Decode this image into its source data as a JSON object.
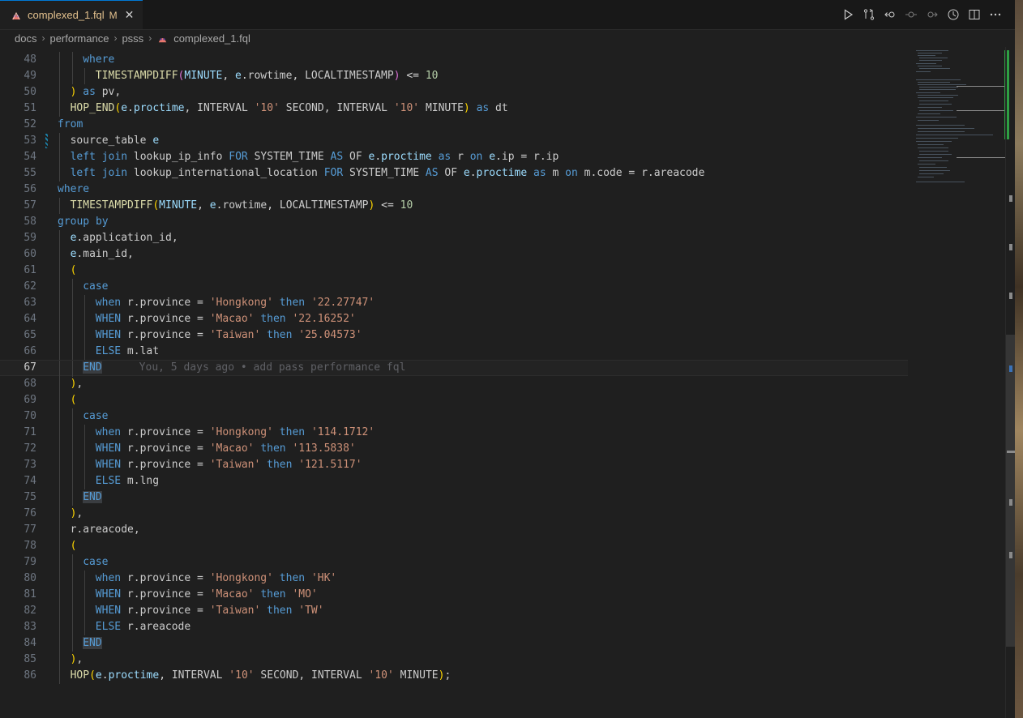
{
  "tab": {
    "title": "complexed_1.fql",
    "modified": "M"
  },
  "breadcrumbs": [
    "docs",
    "performance",
    "psss",
    "complexed_1.fql"
  ],
  "editor": {
    "blame": "You, 5 days ago • add pass performance fql",
    "current_line": "67",
    "lines": [
      {
        "n": "48",
        "indent": 2,
        "tokens": [
          [
            "kw",
            "where"
          ]
        ]
      },
      {
        "n": "49",
        "indent": 3,
        "tokens": [
          [
            "fn",
            "TIMESTAMPDIFF"
          ],
          [
            "p2",
            "("
          ],
          [
            "var",
            "MINUTE"
          ],
          [
            "op",
            ", "
          ],
          [
            "var",
            "e"
          ],
          [
            "op",
            "."
          ],
          [
            "plain",
            "rowtime"
          ],
          [
            "op",
            ", "
          ],
          [
            "plain",
            "LOCALTIMESTAMP"
          ],
          [
            "p2",
            ")"
          ],
          [
            "op",
            " <= "
          ],
          [
            "num",
            "10"
          ]
        ]
      },
      {
        "n": "50",
        "indent": 1,
        "tokens": [
          [
            "p1",
            ")"
          ],
          [
            "plain",
            " "
          ],
          [
            "kw",
            "as"
          ],
          [
            "plain",
            " pv,"
          ]
        ]
      },
      {
        "n": "51",
        "indent": 1,
        "tokens": [
          [
            "fn",
            "HOP_END"
          ],
          [
            "p1",
            "("
          ],
          [
            "var",
            "e"
          ],
          [
            "op",
            "."
          ],
          [
            "var",
            "proctime"
          ],
          [
            "op",
            ", "
          ],
          [
            "plain",
            "INTERVAL "
          ],
          [
            "str",
            "'10'"
          ],
          [
            "plain",
            " SECOND, INTERVAL "
          ],
          [
            "str",
            "'10'"
          ],
          [
            "plain",
            " MINUTE"
          ],
          [
            "p1",
            ")"
          ],
          [
            "plain",
            " "
          ],
          [
            "kw",
            "as"
          ],
          [
            "plain",
            " dt"
          ]
        ]
      },
      {
        "n": "52",
        "indent": 0,
        "tokens": [
          [
            "kw",
            "from"
          ]
        ]
      },
      {
        "n": "53",
        "indent": 1,
        "mark": true,
        "tokens": [
          [
            "plain",
            "source_table "
          ],
          [
            "var",
            "e"
          ]
        ]
      },
      {
        "n": "54",
        "indent": 1,
        "tokens": [
          [
            "kw",
            "left join"
          ],
          [
            "plain",
            " lookup_ip_info "
          ],
          [
            "kw",
            "FOR"
          ],
          [
            "plain",
            " SYSTEM_TIME "
          ],
          [
            "kw",
            "AS"
          ],
          [
            "plain",
            " OF "
          ],
          [
            "var",
            "e"
          ],
          [
            "op",
            "."
          ],
          [
            "var",
            "proctime"
          ],
          [
            "plain",
            " "
          ],
          [
            "kw",
            "as"
          ],
          [
            "plain",
            " r "
          ],
          [
            "kw",
            "on"
          ],
          [
            "plain",
            " "
          ],
          [
            "var",
            "e"
          ],
          [
            "op",
            "."
          ],
          [
            "plain",
            "ip = r.ip"
          ]
        ]
      },
      {
        "n": "55",
        "indent": 1,
        "tokens": [
          [
            "kw",
            "left join"
          ],
          [
            "plain",
            " lookup_international_location "
          ],
          [
            "kw",
            "FOR"
          ],
          [
            "plain",
            " SYSTEM_TIME "
          ],
          [
            "kw",
            "AS"
          ],
          [
            "plain",
            " OF "
          ],
          [
            "var",
            "e"
          ],
          [
            "op",
            "."
          ],
          [
            "var",
            "proctime"
          ],
          [
            "plain",
            " "
          ],
          [
            "kw",
            "as"
          ],
          [
            "plain",
            " m "
          ],
          [
            "kw",
            "on"
          ],
          [
            "plain",
            " m.code = r.areacode"
          ]
        ]
      },
      {
        "n": "56",
        "indent": 0,
        "tokens": [
          [
            "kw",
            "where"
          ]
        ]
      },
      {
        "n": "57",
        "indent": 1,
        "tokens": [
          [
            "fn",
            "TIMESTAMPDIFF"
          ],
          [
            "p1",
            "("
          ],
          [
            "var",
            "MINUTE"
          ],
          [
            "op",
            ", "
          ],
          [
            "var",
            "e"
          ],
          [
            "op",
            "."
          ],
          [
            "plain",
            "rowtime"
          ],
          [
            "op",
            ", "
          ],
          [
            "plain",
            "LOCALTIMESTAMP"
          ],
          [
            "p1",
            ")"
          ],
          [
            "op",
            " <= "
          ],
          [
            "num",
            "10"
          ]
        ]
      },
      {
        "n": "58",
        "indent": 0,
        "tokens": [
          [
            "kw",
            "group by"
          ]
        ]
      },
      {
        "n": "59",
        "indent": 1,
        "tokens": [
          [
            "var",
            "e"
          ],
          [
            "op",
            "."
          ],
          [
            "plain",
            "application_id,"
          ]
        ]
      },
      {
        "n": "60",
        "indent": 1,
        "tokens": [
          [
            "var",
            "e"
          ],
          [
            "op",
            "."
          ],
          [
            "plain",
            "main_id,"
          ]
        ]
      },
      {
        "n": "61",
        "indent": 1,
        "tokens": [
          [
            "p1",
            "("
          ]
        ]
      },
      {
        "n": "62",
        "indent": 2,
        "tokens": [
          [
            "kw",
            "case"
          ]
        ]
      },
      {
        "n": "63",
        "indent": 3,
        "tokens": [
          [
            "kw",
            "when"
          ],
          [
            "plain",
            " r.province = "
          ],
          [
            "str",
            "'Hongkong'"
          ],
          [
            "plain",
            " "
          ],
          [
            "kw",
            "then"
          ],
          [
            "plain",
            " "
          ],
          [
            "str",
            "'22.27747'"
          ]
        ]
      },
      {
        "n": "64",
        "indent": 3,
        "tokens": [
          [
            "kw",
            "WHEN"
          ],
          [
            "plain",
            " r.province = "
          ],
          [
            "str",
            "'Macao'"
          ],
          [
            "plain",
            " "
          ],
          [
            "kw",
            "then"
          ],
          [
            "plain",
            " "
          ],
          [
            "str",
            "'22.16252'"
          ]
        ]
      },
      {
        "n": "65",
        "indent": 3,
        "tokens": [
          [
            "kw",
            "WHEN"
          ],
          [
            "plain",
            " r.province = "
          ],
          [
            "str",
            "'Taiwan'"
          ],
          [
            "plain",
            " "
          ],
          [
            "kw",
            "then"
          ],
          [
            "plain",
            " "
          ],
          [
            "str",
            "'25.04573'"
          ]
        ]
      },
      {
        "n": "66",
        "indent": 3,
        "tokens": [
          [
            "kw",
            "ELSE"
          ],
          [
            "plain",
            " m.lat"
          ]
        ]
      },
      {
        "n": "67",
        "indent": 2,
        "current": true,
        "tokens": [
          [
            "endkw",
            "END"
          ]
        ]
      },
      {
        "n": "68",
        "indent": 1,
        "tokens": [
          [
            "p1",
            ")"
          ],
          [
            "plain",
            ","
          ]
        ]
      },
      {
        "n": "69",
        "indent": 1,
        "tokens": [
          [
            "p1",
            "("
          ]
        ]
      },
      {
        "n": "70",
        "indent": 2,
        "tokens": [
          [
            "kw",
            "case"
          ]
        ]
      },
      {
        "n": "71",
        "indent": 3,
        "tokens": [
          [
            "kw",
            "when"
          ],
          [
            "plain",
            " r.province = "
          ],
          [
            "str",
            "'Hongkong'"
          ],
          [
            "plain",
            " "
          ],
          [
            "kw",
            "then"
          ],
          [
            "plain",
            " "
          ],
          [
            "str",
            "'114.1712'"
          ]
        ]
      },
      {
        "n": "72",
        "indent": 3,
        "tokens": [
          [
            "kw",
            "WHEN"
          ],
          [
            "plain",
            " r.province = "
          ],
          [
            "str",
            "'Macao'"
          ],
          [
            "plain",
            " "
          ],
          [
            "kw",
            "then"
          ],
          [
            "plain",
            " "
          ],
          [
            "str",
            "'113.5838'"
          ]
        ]
      },
      {
        "n": "73",
        "indent": 3,
        "tokens": [
          [
            "kw",
            "WHEN"
          ],
          [
            "plain",
            " r.province = "
          ],
          [
            "str",
            "'Taiwan'"
          ],
          [
            "plain",
            " "
          ],
          [
            "kw",
            "then"
          ],
          [
            "plain",
            " "
          ],
          [
            "str",
            "'121.5117'"
          ]
        ]
      },
      {
        "n": "74",
        "indent": 3,
        "tokens": [
          [
            "kw",
            "ELSE"
          ],
          [
            "plain",
            " m.lng"
          ]
        ]
      },
      {
        "n": "75",
        "indent": 2,
        "tokens": [
          [
            "endkw",
            "END"
          ]
        ]
      },
      {
        "n": "76",
        "indent": 1,
        "tokens": [
          [
            "p1",
            ")"
          ],
          [
            "plain",
            ","
          ]
        ]
      },
      {
        "n": "77",
        "indent": 1,
        "tokens": [
          [
            "plain",
            "r.areacode,"
          ]
        ]
      },
      {
        "n": "78",
        "indent": 1,
        "tokens": [
          [
            "p1",
            "("
          ]
        ]
      },
      {
        "n": "79",
        "indent": 2,
        "tokens": [
          [
            "kw",
            "case"
          ]
        ]
      },
      {
        "n": "80",
        "indent": 3,
        "tokens": [
          [
            "kw",
            "when"
          ],
          [
            "plain",
            " r.province = "
          ],
          [
            "str",
            "'Hongkong'"
          ],
          [
            "plain",
            " "
          ],
          [
            "kw",
            "then"
          ],
          [
            "plain",
            " "
          ],
          [
            "str",
            "'HK'"
          ]
        ]
      },
      {
        "n": "81",
        "indent": 3,
        "tokens": [
          [
            "kw",
            "WHEN"
          ],
          [
            "plain",
            " r.province = "
          ],
          [
            "str",
            "'Macao'"
          ],
          [
            "plain",
            " "
          ],
          [
            "kw",
            "then"
          ],
          [
            "plain",
            " "
          ],
          [
            "str",
            "'MO'"
          ]
        ]
      },
      {
        "n": "82",
        "indent": 3,
        "tokens": [
          [
            "kw",
            "WHEN"
          ],
          [
            "plain",
            " r.province = "
          ],
          [
            "str",
            "'Taiwan'"
          ],
          [
            "plain",
            " "
          ],
          [
            "kw",
            "then"
          ],
          [
            "plain",
            " "
          ],
          [
            "str",
            "'TW'"
          ]
        ]
      },
      {
        "n": "83",
        "indent": 3,
        "tokens": [
          [
            "kw",
            "ELSE"
          ],
          [
            "plain",
            " r.areacode"
          ]
        ]
      },
      {
        "n": "84",
        "indent": 2,
        "tokens": [
          [
            "endkw",
            "END"
          ]
        ]
      },
      {
        "n": "85",
        "indent": 1,
        "tokens": [
          [
            "p1",
            ")"
          ],
          [
            "plain",
            ","
          ]
        ]
      },
      {
        "n": "86",
        "indent": 1,
        "tokens": [
          [
            "fn",
            "HOP"
          ],
          [
            "p1",
            "("
          ],
          [
            "var",
            "e"
          ],
          [
            "op",
            "."
          ],
          [
            "var",
            "proctime"
          ],
          [
            "op",
            ", "
          ],
          [
            "plain",
            "INTERVAL "
          ],
          [
            "str",
            "'10'"
          ],
          [
            "plain",
            " SECOND, INTERVAL "
          ],
          [
            "str",
            "'10'"
          ],
          [
            "plain",
            " MINUTE"
          ],
          [
            "p1",
            ")"
          ],
          [
            "plain",
            ";"
          ]
        ]
      }
    ]
  },
  "icons": {
    "actions": [
      "run-icon",
      "compare-changes-icon",
      "go-back-icon",
      "go-to-commit-icon",
      "go-forward-icon",
      "timeline-icon",
      "split-editor-icon",
      "more-actions-icon"
    ]
  },
  "colors": {
    "keyword": "#569cd6",
    "function": "#dcdcaa",
    "string": "#ce9178",
    "number": "#b5cea8",
    "variable": "#9cdcfe",
    "bracket": "#ffd700",
    "accent": "#0078d4"
  }
}
